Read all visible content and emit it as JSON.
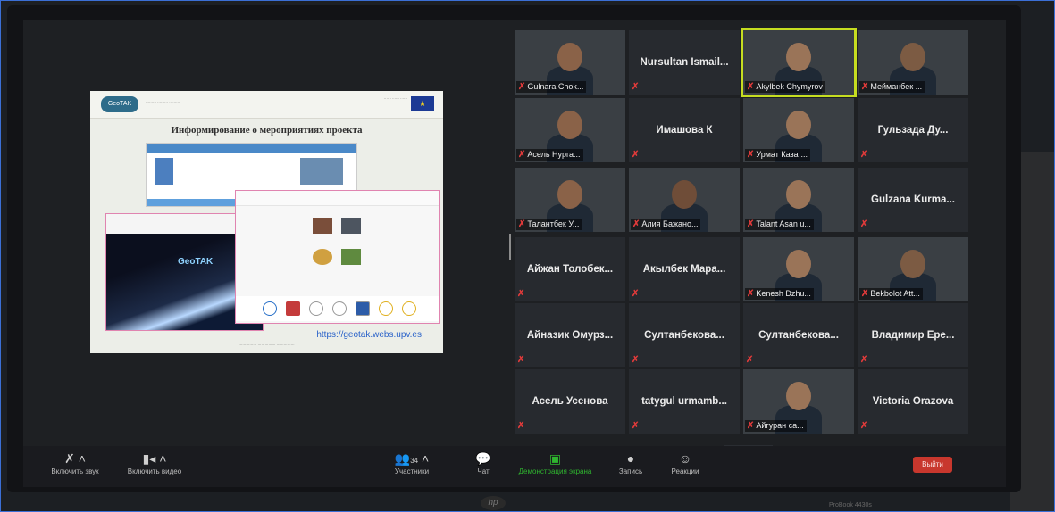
{
  "slide": {
    "title": "Информирование о мероприятиях проекта",
    "geo_title": "GeoTAK",
    "url": "https://geotak.webs.upv.es"
  },
  "participants": [
    {
      "name": "Gulnara Chok...",
      "video": true
    },
    {
      "name": "Nursultan Ismail...",
      "video": false
    },
    {
      "name": "Akylbek Chymyrov",
      "video": true,
      "active": true
    },
    {
      "name": "Мейманбек ...",
      "video": true
    },
    {
      "name": "Асель Нурга...",
      "video": true
    },
    {
      "name": "Имашова К",
      "video": false
    },
    {
      "name": "Урмат Казат...",
      "video": true
    },
    {
      "name": "Гульзада Ду...",
      "video": false
    },
    {
      "name": "Талантбек У...",
      "video": true
    },
    {
      "name": "Алия Бажано...",
      "video": true
    },
    {
      "name": "Talant Asan u...",
      "video": true
    },
    {
      "name": "Gulzana Kurma...",
      "video": false
    },
    {
      "name": "Айжан Толобек...",
      "video": false
    },
    {
      "name": "Акылбек Мара...",
      "video": false
    },
    {
      "name": "Kenesh Dzhu...",
      "video": true
    },
    {
      "name": "Bekbolot Att...",
      "video": true
    },
    {
      "name": "Айназик Омурз...",
      "video": false
    },
    {
      "name": "Султанбекова...",
      "video": false
    },
    {
      "name": "Султанбекова...",
      "video": false
    },
    {
      "name": "Владимир Ере...",
      "video": false
    },
    {
      "name": "Асель Усенова",
      "video": false
    },
    {
      "name": "tatygul urmamb...",
      "video": false
    },
    {
      "name": "Айгуран са...",
      "video": true
    },
    {
      "name": "Victoria Orazova",
      "video": false
    }
  ],
  "toolbar": {
    "audio": "Включить звук",
    "video": "Включить видео",
    "participants": "Участники",
    "participants_count": "34",
    "chat": "Чат",
    "share": "Демонстрация экрана",
    "record": "Запись",
    "reactions": "Реакции",
    "leave": "Выйти"
  },
  "hardware": {
    "brand": "hp",
    "model": "ProBook 4430s"
  },
  "colors": {
    "active_speaker": "#c6dd20",
    "muted_icon": "#e03a3a",
    "leave_button": "#c8372d",
    "share_green": "#2fb52f"
  }
}
